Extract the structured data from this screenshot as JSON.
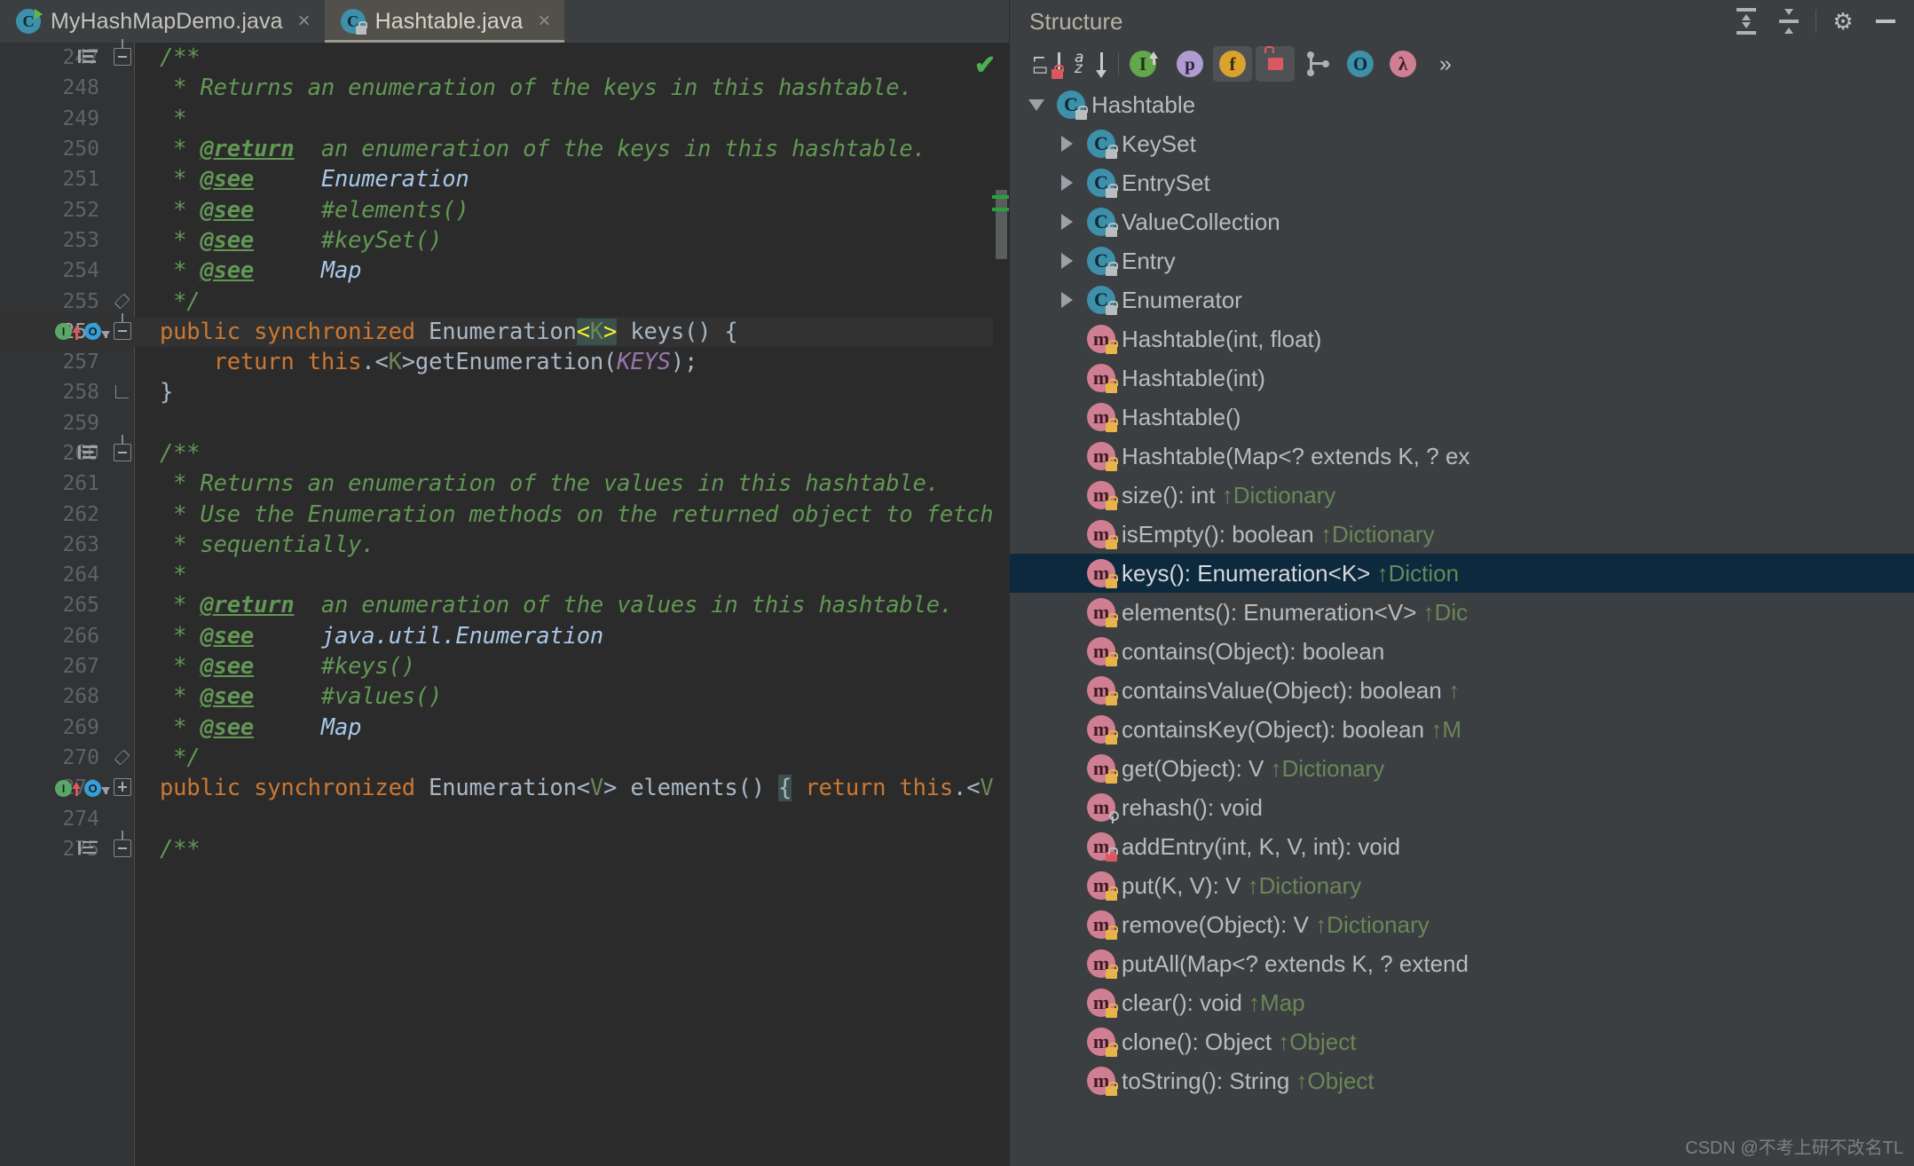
{
  "window": {
    "theme_bg": "#2b2b2b",
    "panel_bg": "#3c3f41"
  },
  "editor": {
    "tabs": [
      {
        "label": "MyHashMapDemo.java",
        "icon": "java-class-runnable-icon",
        "active": false,
        "close_glyph": "×"
      },
      {
        "label": "Hashtable.java",
        "icon": "java-class-readonly-icon",
        "active": true,
        "close_glyph": "×"
      }
    ],
    "inspection_status": "✔",
    "lines": [
      {
        "no": "247",
        "segments": [
          {
            "t": "/**",
            "c": "cm"
          }
        ],
        "fold": "start",
        "bookmark": true
      },
      {
        "no": "248",
        "segments": [
          {
            "t": " * Returns an enumeration of the keys in this hashtable.",
            "c": "cm"
          }
        ]
      },
      {
        "no": "249",
        "segments": [
          {
            "t": " *",
            "c": "cm"
          }
        ]
      },
      {
        "no": "250",
        "segments": [
          {
            "t": " * ",
            "c": "cm"
          },
          {
            "t": "@return",
            "c": "tag"
          },
          {
            "t": "  an enumeration of the keys in this hashtable.",
            "c": "cm"
          }
        ]
      },
      {
        "no": "251",
        "segments": [
          {
            "t": " * ",
            "c": "cm"
          },
          {
            "t": "@see",
            "c": "tag"
          },
          {
            "t": "     ",
            "c": "cm"
          },
          {
            "t": "Enumeration",
            "c": "ref"
          }
        ]
      },
      {
        "no": "252",
        "segments": [
          {
            "t": " * ",
            "c": "cm"
          },
          {
            "t": "@see",
            "c": "tag"
          },
          {
            "t": "     #elements()",
            "c": "cm"
          }
        ]
      },
      {
        "no": "253",
        "segments": [
          {
            "t": " * ",
            "c": "cm"
          },
          {
            "t": "@see",
            "c": "tag"
          },
          {
            "t": "     #keySet()",
            "c": "cm"
          }
        ]
      },
      {
        "no": "254",
        "segments": [
          {
            "t": " * ",
            "c": "cm"
          },
          {
            "t": "@see",
            "c": "tag"
          },
          {
            "t": "     ",
            "c": "cm"
          },
          {
            "t": "Map",
            "c": "ref"
          }
        ]
      },
      {
        "no": "255",
        "segments": [
          {
            "t": " */",
            "c": "cm"
          }
        ],
        "fold": "end"
      },
      {
        "no": "256",
        "current": true,
        "gutter_badges": [
          "implemented-green",
          "overrides-up-red",
          "implementation-blue",
          "overrides-down-grey"
        ],
        "fold": "start",
        "segments": [
          {
            "t": "public synchronized ",
            "c": "kw"
          },
          {
            "t": "Enumeration",
            "c": "cls"
          },
          {
            "t": "<",
            "c": "angle-hl"
          },
          {
            "t": "K",
            "c": "typ brace-hl"
          },
          {
            "t": ">",
            "c": "angle-hl"
          },
          {
            "t": " ",
            "c": "pl"
          },
          {
            "t": "keys",
            "c": "fn"
          },
          {
            "t": "() {",
            "c": "pl"
          }
        ]
      },
      {
        "no": "257",
        "segments": [
          {
            "t": "    ",
            "c": "pl"
          },
          {
            "t": "return this",
            "c": "kw"
          },
          {
            "t": ".<",
            "c": "pl"
          },
          {
            "t": "K",
            "c": "typ"
          },
          {
            "t": ">getEnumeration(",
            "c": "pl"
          },
          {
            "t": "KEYS",
            "c": "sf"
          },
          {
            "t": ");",
            "c": "pl"
          }
        ]
      },
      {
        "no": "258",
        "segments": [
          {
            "t": "}",
            "c": "pl"
          }
        ],
        "fold": "endcap"
      },
      {
        "no": "259",
        "segments": []
      },
      {
        "no": "260",
        "segments": [
          {
            "t": "/**",
            "c": "cm"
          }
        ],
        "fold": "start",
        "bookmark": true
      },
      {
        "no": "261",
        "segments": [
          {
            "t": " * Returns an enumeration of the values in this hashtable.",
            "c": "cm"
          }
        ]
      },
      {
        "no": "262",
        "segments": [
          {
            "t": " * Use the Enumeration methods on the returned object to fetch the eleme",
            "c": "cm"
          }
        ]
      },
      {
        "no": "263",
        "segments": [
          {
            "t": " * sequentially.",
            "c": "cm"
          }
        ]
      },
      {
        "no": "264",
        "segments": [
          {
            "t": " *",
            "c": "cm"
          }
        ]
      },
      {
        "no": "265",
        "segments": [
          {
            "t": " * ",
            "c": "cm"
          },
          {
            "t": "@return",
            "c": "tag"
          },
          {
            "t": "  an enumeration of the values in this hashtable.",
            "c": "cm"
          }
        ]
      },
      {
        "no": "266",
        "segments": [
          {
            "t": " * ",
            "c": "cm"
          },
          {
            "t": "@see",
            "c": "tag"
          },
          {
            "t": "     ",
            "c": "cm"
          },
          {
            "t": "java.util.Enumeration",
            "c": "ref"
          }
        ]
      },
      {
        "no": "267",
        "segments": [
          {
            "t": " * ",
            "c": "cm"
          },
          {
            "t": "@see",
            "c": "tag"
          },
          {
            "t": "     #keys()",
            "c": "cm"
          }
        ]
      },
      {
        "no": "268",
        "segments": [
          {
            "t": " * ",
            "c": "cm"
          },
          {
            "t": "@see",
            "c": "tag"
          },
          {
            "t": "     #values()",
            "c": "cm"
          }
        ]
      },
      {
        "no": "269",
        "segments": [
          {
            "t": " * ",
            "c": "cm"
          },
          {
            "t": "@see",
            "c": "tag"
          },
          {
            "t": "     ",
            "c": "cm"
          },
          {
            "t": "Map",
            "c": "ref"
          }
        ]
      },
      {
        "no": "270",
        "segments": [
          {
            "t": " */",
            "c": "cm"
          }
        ],
        "fold": "end"
      },
      {
        "no": "271",
        "gutter_badges": [
          "implemented-green",
          "overrides-up-red",
          "implementation-blue",
          "overrides-down-grey"
        ],
        "fold": "plus",
        "segments": [
          {
            "t": "public synchronized ",
            "c": "kw"
          },
          {
            "t": "Enumeration",
            "c": "cls"
          },
          {
            "t": "<",
            "c": "pl"
          },
          {
            "t": "V",
            "c": "typ"
          },
          {
            "t": "> ",
            "c": "pl"
          },
          {
            "t": "elements",
            "c": "fn"
          },
          {
            "t": "() ",
            "c": "pl"
          },
          {
            "t": "{",
            "c": "pl brace-hl"
          },
          {
            "t": " ",
            "c": "pl"
          },
          {
            "t": "return this",
            "c": "kw"
          },
          {
            "t": ".<",
            "c": "pl"
          },
          {
            "t": "V",
            "c": "typ"
          },
          {
            "t": ">getEnumer",
            "c": "pl"
          }
        ]
      },
      {
        "no": "274",
        "segments": []
      },
      {
        "no": "275",
        "segments": [
          {
            "t": "/**",
            "c": "cm"
          }
        ],
        "bookmark": true,
        "fold": "start"
      }
    ]
  },
  "structure": {
    "title": "Structure",
    "header_buttons": [
      {
        "name": "expand-all-icon",
        "tip": "Expand All"
      },
      {
        "name": "collapse-all-icon",
        "tip": "Collapse All"
      },
      {
        "name": "gear-icon",
        "tip": "Settings",
        "glyph": "⚙"
      },
      {
        "name": "hide-icon",
        "tip": "Hide"
      }
    ],
    "toolbar": [
      {
        "name": "sort-by-visibility-button",
        "label": "↓",
        "active": false
      },
      {
        "name": "sort-alphabetically-button",
        "label": "a↓",
        "active": false
      },
      {
        "name": "show-inherited-button",
        "label": "I",
        "active": false
      },
      {
        "name": "show-properties-button",
        "label": "p",
        "active": false
      },
      {
        "name": "show-fields-button",
        "label": "f",
        "active": true
      },
      {
        "name": "show-non-public-button",
        "label": "\u0001",
        "active": true
      },
      {
        "name": "group-methods-button",
        "label": "",
        "active": false
      },
      {
        "name": "show-anonymous-classes-button",
        "label": "O",
        "active": false
      },
      {
        "name": "show-lambdas-button",
        "label": "λ",
        "active": false
      },
      {
        "name": "more-actions-button",
        "label": "»",
        "active": false
      }
    ],
    "tree": [
      {
        "label": "Hashtable",
        "icon": "class-icon",
        "badge": "lock",
        "twisty": "down",
        "indent": 0,
        "selected": false
      },
      {
        "label": "KeySet",
        "icon": "class-icon",
        "badge": "lock",
        "twisty": "right",
        "indent": 1,
        "selected": false
      },
      {
        "label": "EntrySet",
        "icon": "class-icon",
        "badge": "lock",
        "twisty": "right",
        "indent": 1,
        "selected": false
      },
      {
        "label": "ValueCollection",
        "icon": "class-icon",
        "badge": "lock",
        "twisty": "right",
        "indent": 1,
        "selected": false
      },
      {
        "label": "Entry",
        "icon": "class-icon",
        "badge": "lock",
        "twisty": "right",
        "indent": 1,
        "selected": false
      },
      {
        "label": "Enumerator",
        "icon": "class-icon",
        "badge": "lock",
        "twisty": "right",
        "indent": 1,
        "selected": false
      },
      {
        "label": "Hashtable(int, float)",
        "icon": "method-icon",
        "badge": "lock-gold",
        "twisty": "none",
        "indent": 1,
        "selected": false
      },
      {
        "label": "Hashtable(int)",
        "icon": "method-icon",
        "badge": "lock-gold",
        "twisty": "none",
        "indent": 1,
        "selected": false
      },
      {
        "label": "Hashtable()",
        "icon": "method-icon",
        "badge": "lock-gold",
        "twisty": "none",
        "indent": 1,
        "selected": false
      },
      {
        "label": "Hashtable(Map<? extends K, ? ex",
        "icon": "method-icon",
        "badge": "lock-gold",
        "twisty": "none",
        "indent": 1,
        "selected": false
      },
      {
        "label": "size(): int ",
        "sup": "↑Dictionary",
        "icon": "method-icon",
        "badge": "lock-gold",
        "twisty": "none",
        "indent": 1,
        "selected": false
      },
      {
        "label": "isEmpty(): boolean ",
        "sup": "↑Dictionary",
        "icon": "method-icon",
        "badge": "lock-gold",
        "twisty": "none",
        "indent": 1,
        "selected": false
      },
      {
        "label": "keys(): Enumeration<K> ",
        "sup": "↑Diction",
        "icon": "method-icon",
        "badge": "lock-gold",
        "twisty": "none",
        "indent": 1,
        "selected": true
      },
      {
        "label": "elements(): Enumeration<V> ",
        "sup": "↑Dic",
        "icon": "method-icon",
        "badge": "lock-gold",
        "twisty": "none",
        "indent": 1,
        "selected": false
      },
      {
        "label": "contains(Object): boolean",
        "icon": "method-icon",
        "badge": "lock-gold",
        "twisty": "none",
        "indent": 1,
        "selected": false
      },
      {
        "label": "containsValue(Object): boolean ",
        "sup": "↑",
        "icon": "method-icon",
        "badge": "lock-gold",
        "twisty": "none",
        "indent": 1,
        "selected": false
      },
      {
        "label": "containsKey(Object): boolean ",
        "sup": "↑M",
        "icon": "method-icon",
        "badge": "lock-gold",
        "twisty": "none",
        "indent": 1,
        "selected": false
      },
      {
        "label": "get(Object): V ",
        "sup": "↑Dictionary",
        "icon": "method-icon",
        "badge": "lock-gold",
        "twisty": "none",
        "indent": 1,
        "selected": false
      },
      {
        "label": "rehash(): void",
        "icon": "method-icon",
        "badge": "key",
        "twisty": "none",
        "indent": 1,
        "selected": false
      },
      {
        "label": "addEntry(int, K, V, int): void",
        "icon": "method-icon",
        "badge": "lock-red",
        "twisty": "none",
        "indent": 1,
        "selected": false
      },
      {
        "label": "put(K, V): V ",
        "sup": "↑Dictionary",
        "icon": "method-icon",
        "badge": "lock-gold",
        "twisty": "none",
        "indent": 1,
        "selected": false
      },
      {
        "label": "remove(Object): V ",
        "sup": "↑Dictionary",
        "icon": "method-icon",
        "badge": "lock-gold",
        "twisty": "none",
        "indent": 1,
        "selected": false
      },
      {
        "label": "putAll(Map<? extends K, ? extend",
        "icon": "method-icon",
        "badge": "lock-gold",
        "twisty": "none",
        "indent": 1,
        "selected": false
      },
      {
        "label": "clear(): void ",
        "sup": "↑Map",
        "icon": "method-icon",
        "badge": "lock-gold",
        "twisty": "none",
        "indent": 1,
        "selected": false
      },
      {
        "label": "clone(): Object ",
        "sup": "↑Object",
        "icon": "method-icon",
        "badge": "lock-gold",
        "twisty": "none",
        "indent": 1,
        "selected": false
      },
      {
        "label": "toString(): String ",
        "sup": "↑Object",
        "icon": "method-icon",
        "badge": "lock-gold",
        "twisty": "none",
        "indent": 1,
        "selected": false
      }
    ]
  },
  "watermark": "CSDN @不考上研不改名TL"
}
